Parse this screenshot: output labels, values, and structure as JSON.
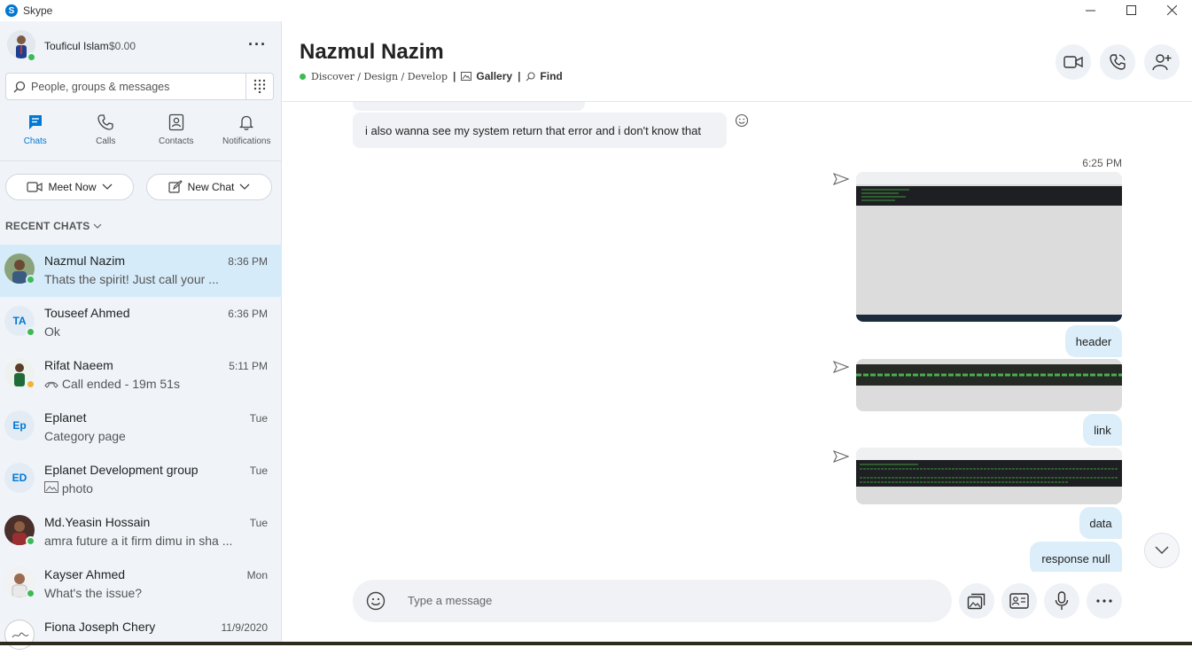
{
  "window": {
    "title": "Skype"
  },
  "profile": {
    "name": "Touficul Islam",
    "credit": "$0.00"
  },
  "search": {
    "placeholder": "People, groups & messages"
  },
  "nav": [
    {
      "label": "Chats"
    },
    {
      "label": "Calls"
    },
    {
      "label": "Contacts"
    },
    {
      "label": "Notifications"
    }
  ],
  "buttons": {
    "meet_now": "Meet Now",
    "new_chat": "New Chat"
  },
  "recent_label": "RECENT CHATS",
  "chats": [
    {
      "name": "Nazmul Nazim",
      "time": "8:36 PM",
      "preview": "Thats the spirit! Just call your ...",
      "initials": "",
      "presence": "#3cba54"
    },
    {
      "name": "Touseef Ahmed",
      "time": "6:36 PM",
      "preview": "Ok",
      "initials": "TA",
      "presence": "#3cba54"
    },
    {
      "name": "Rifat Naeem",
      "time": "5:11 PM",
      "preview": "Call ended - 19m 51s",
      "initials": "",
      "presence": "#f2b233"
    },
    {
      "name": "Eplanet",
      "time": "Tue",
      "preview": "Category page",
      "initials": "Ep",
      "presence": ""
    },
    {
      "name": "Eplanet Development group",
      "time": "Tue",
      "preview": "photo",
      "initials": "ED",
      "presence": ""
    },
    {
      "name": "Md.Yeasin Hossain",
      "time": "Tue",
      "preview": "amra future a it firm dimu in sha ...",
      "initials": "",
      "presence": "#3cba54"
    },
    {
      "name": "Kayser Ahmed",
      "time": "Mon",
      "preview": "What's the issue?",
      "initials": "",
      "presence": "#3cba54"
    },
    {
      "name": "Fiona Joseph Chery",
      "time": "11/9/2020",
      "preview": "",
      "initials": "",
      "presence": ""
    }
  ],
  "conversation": {
    "title": "Nazmul Nazim",
    "mood": "Discover / Design / Develop",
    "gallery": "Gallery",
    "find": "Find",
    "messages": {
      "incoming_1": "i also wanna see my system return that error and i don't know that",
      "timestamp": "6:25 PM",
      "out_header": "header",
      "out_link": "link",
      "out_data": "data",
      "out_response": "response null"
    },
    "composer_placeholder": "Type a message"
  },
  "colors": {
    "accent": "#0078d4",
    "online": "#3cba54",
    "away": "#f2b233",
    "selected": "#d6ebf9"
  }
}
